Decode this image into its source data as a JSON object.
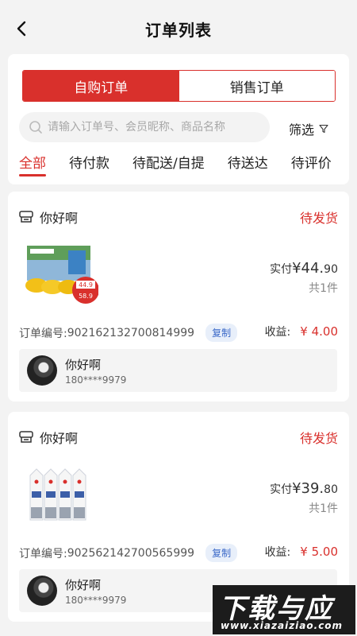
{
  "header": {
    "title": "订单列表"
  },
  "segments": {
    "self": "自购订单",
    "sales": "销售订单"
  },
  "search": {
    "placeholder": "请输入订单号、会员昵称、商品名称"
  },
  "filter": {
    "label": "筛选"
  },
  "tabs": [
    "全部",
    "待付款",
    "待配送/自提",
    "待送达",
    "待评价"
  ],
  "orders": [
    {
      "shop": "你好啊",
      "status": "待发货",
      "paid_prefix": "实付",
      "currency": "¥",
      "paid_int": "44.",
      "paid_dec": "90",
      "count": "共1件",
      "order_label": "订单编号:",
      "order_no": "902162132700814999",
      "copy": "复制",
      "income_label": "收益:",
      "income": "¥ 4.00",
      "buyer_name": "你好啊",
      "buyer_phone": "180****9979",
      "thumb_badge_1": "44.9",
      "thumb_badge_2": "58.9"
    },
    {
      "shop": "你好啊",
      "status": "待发货",
      "paid_prefix": "实付",
      "currency": "¥",
      "paid_int": "39.",
      "paid_dec": "80",
      "count": "共1件",
      "order_label": "订单编号:",
      "order_no": "902562142700565999",
      "copy": "复制",
      "income_label": "收益:",
      "income": "¥ 5.00",
      "buyer_name": "你好啊",
      "buyer_phone": "180****9979"
    }
  ],
  "watermark": {
    "line1": "下载与应用",
    "line2": "www.xiazaiziao.com"
  },
  "colors": {
    "accent": "#d9302c",
    "page_bg": "#f3f3f3"
  }
}
